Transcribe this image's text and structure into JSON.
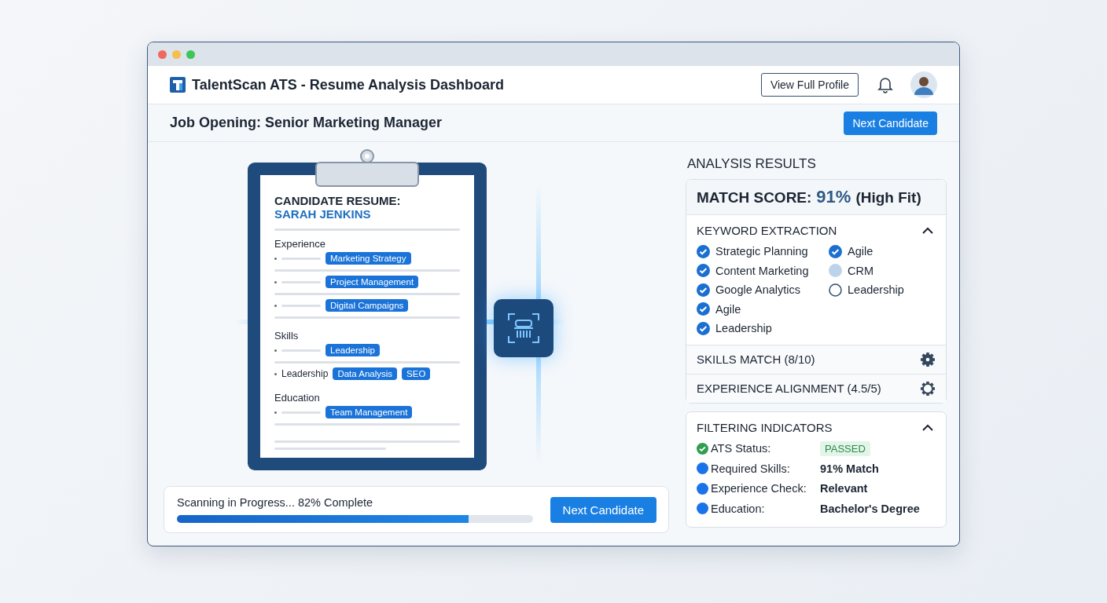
{
  "header": {
    "title": "TalentScan ATS - Resume Analysis Dashboard",
    "profile_button": "View Full Profile"
  },
  "subheader": {
    "title": "Job Opening: Senior Marketing Manager",
    "button": "Next Candidate"
  },
  "resume": {
    "title": "CANDIDATE RESUME:",
    "name": "SARAH JENKINS",
    "sections": [
      {
        "heading": "Experience",
        "rows": [
          {
            "tags": [
              "Marketing Strategy"
            ]
          },
          {
            "tags": [
              "Project Management"
            ]
          },
          {
            "tags": [
              "Digital Campaigns"
            ]
          }
        ]
      },
      {
        "heading": "Skills",
        "rows": [
          {
            "tags": [
              "Leadership"
            ]
          },
          {
            "label": "Leadership",
            "tags": [
              "Data Analysis",
              "SEO"
            ]
          }
        ]
      },
      {
        "heading": "Education",
        "rows": [
          {
            "tags": [
              "Team Management"
            ]
          }
        ]
      }
    ]
  },
  "progress": {
    "text": "Scanning in Progress... 82% Complete",
    "level": 0.82,
    "button": "Next Candidate"
  },
  "analysis": {
    "title": "ANALYSIS RESULTS",
    "match_label": "MATCH SCORE:",
    "match_value": "91%",
    "match_note": "(High Fit)",
    "keywords": {
      "title": "KEYWORD EXTRACTION",
      "expanded": true,
      "items": [
        {
          "label": "Strategic Planning",
          "kind": "checked"
        },
        {
          "label": "Content Marketing",
          "kind": "checked"
        },
        {
          "label": "Google Analytics",
          "kind": "checked"
        },
        {
          "label": "Agile",
          "kind": "checked"
        },
        {
          "label": "Leadership",
          "kind": "checked"
        },
        {
          "label": "Agile",
          "kind": "checked"
        },
        {
          "label": "CRM",
          "kind": "partial"
        },
        {
          "label": "Leadership",
          "kind": "empty"
        }
      ]
    },
    "sections": [
      {
        "title": "SKILLS MATCH (8/10)",
        "expanded": false
      },
      {
        "title": "EXPERIENCE ALIGNMENT (4.5/5)",
        "expanded": false
      }
    ]
  },
  "filters": {
    "title": "FILTERING INDICATORS",
    "expanded": true,
    "items": [
      {
        "label": "ATS Status:",
        "value": "PASSED",
        "kind": "badge",
        "color": "#2e9e4f"
      },
      {
        "label": "Required Skills:",
        "value": "91% Match",
        "kind": "text",
        "color": "#1a73e8"
      },
      {
        "label": "Experience Check:",
        "value": "Relevant",
        "kind": "text",
        "color": "#1a73e8"
      },
      {
        "label": "Education:",
        "value": "Bachelor's Degree",
        "kind": "text",
        "color": "#1a73e8"
      }
    ]
  }
}
